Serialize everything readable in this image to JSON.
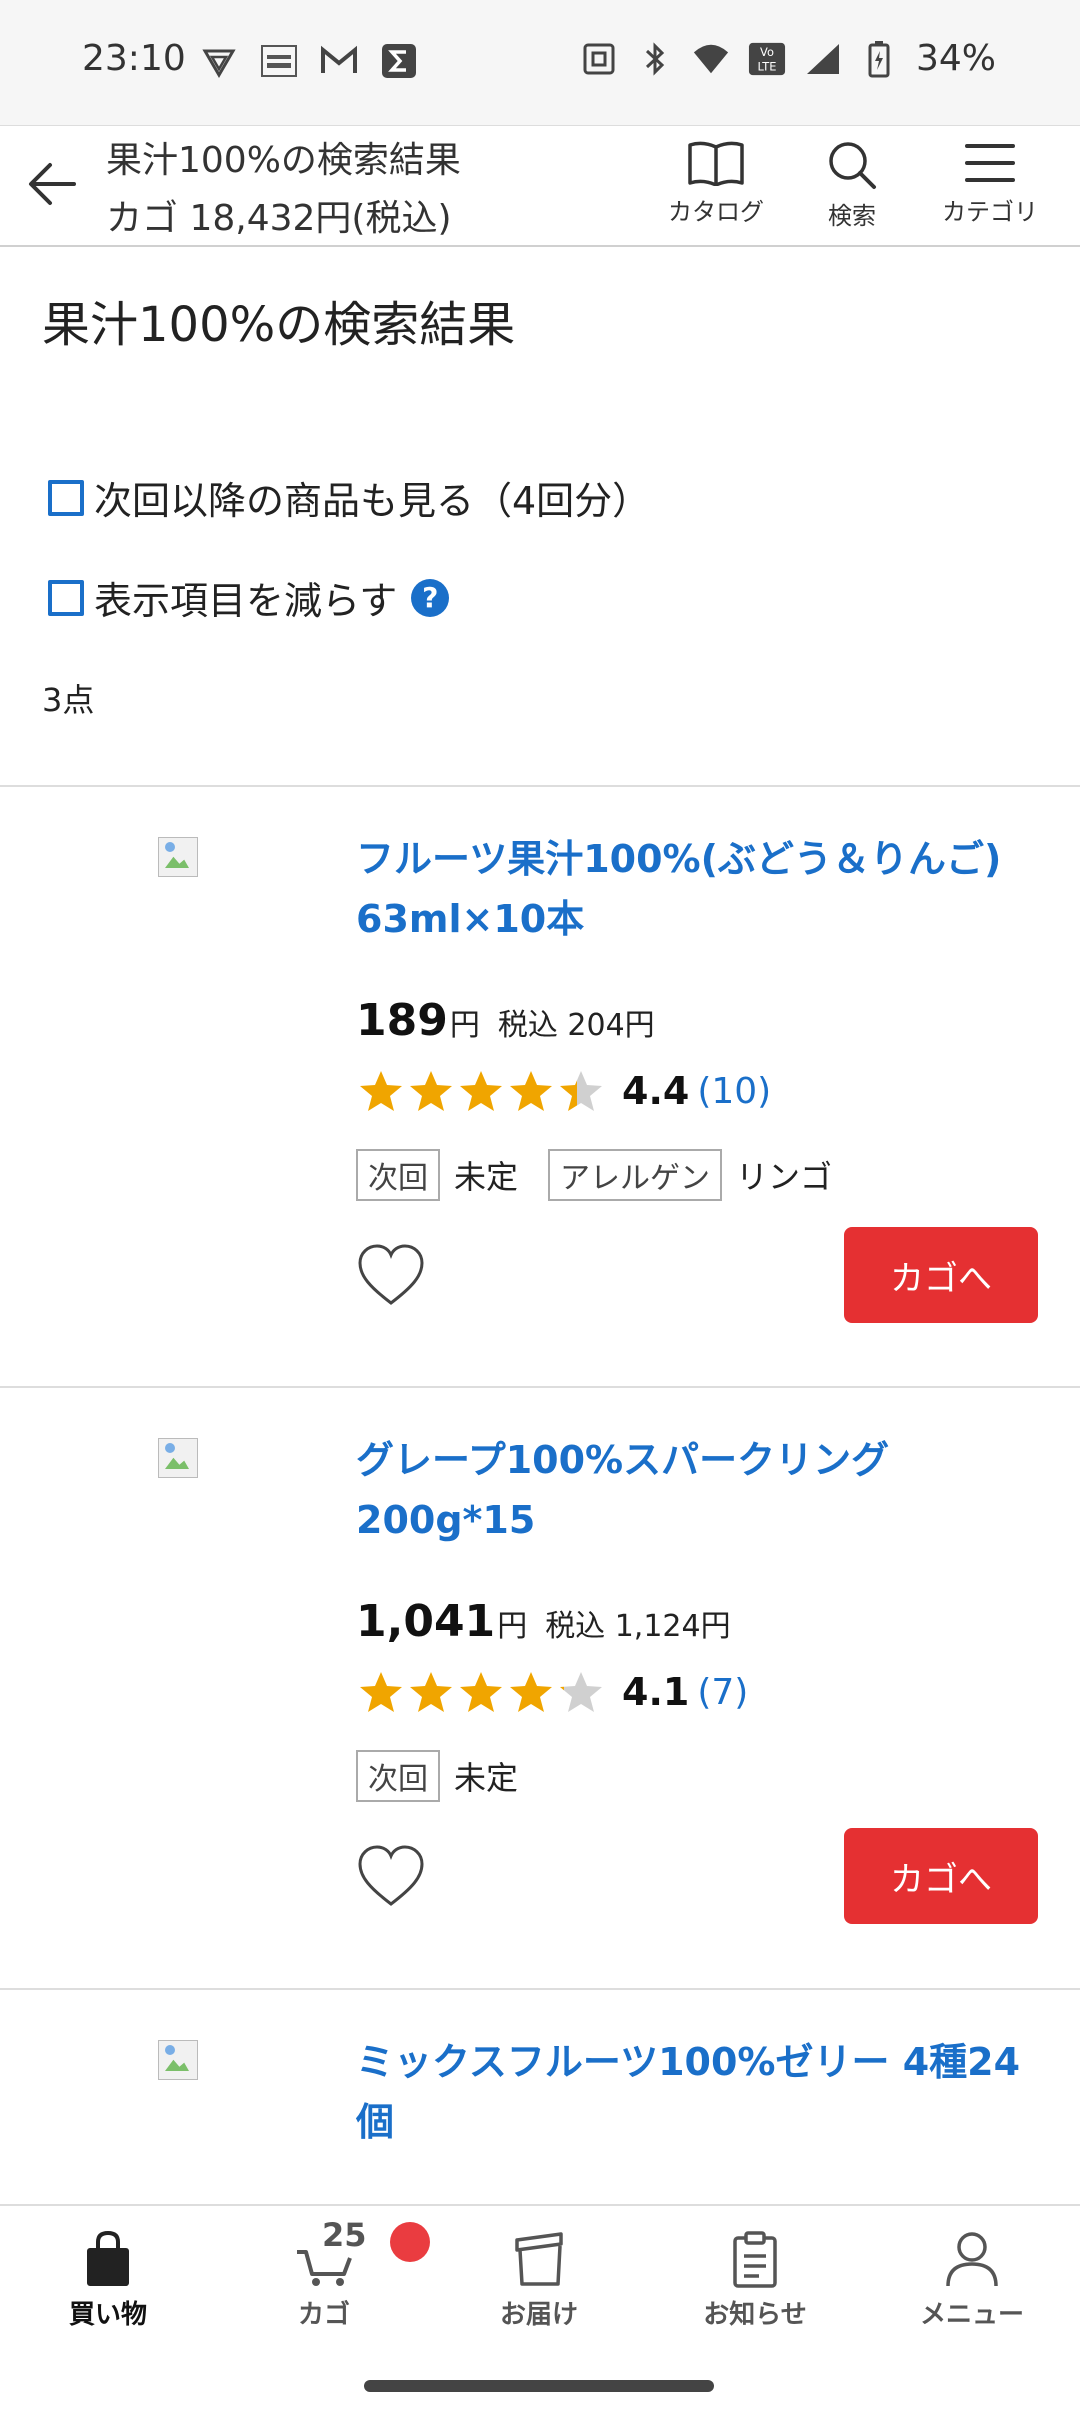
{
  "status_bar": {
    "time": "23:10",
    "battery": "34%",
    "left_icons": [
      "vpn-icon",
      "sports-bull-icon",
      "gmail-icon",
      "sigma-icon"
    ],
    "right_icons": [
      "nfc-icon",
      "bluetooth-icon",
      "wifi-icon",
      "volte-icon",
      "signal-icon",
      "battery-icon"
    ]
  },
  "header": {
    "title": "果汁100%の検索結果",
    "cart_total": "カゴ 18,432円(税込)",
    "catalog_label": "カタログ",
    "search_label": "検索",
    "category_label": "カテゴリ"
  },
  "page": {
    "title": "果汁100%の検索結果",
    "filter_next": "次回以降の商品も見る（4回分）",
    "filter_reduce": "表示項目を減らす",
    "help": "?",
    "count": "3点"
  },
  "products": [
    {
      "name": "フルーツ果汁100%(ぶどう＆りんご) 63ml×10本",
      "price": "189",
      "yen": "円",
      "tax_price": "税込 204円",
      "rating": "4.4",
      "rating_value": 4.4,
      "reviews": "(10)",
      "tag1_label": "次回",
      "tag1_value": "未定",
      "tag2_label": "アレルゲン",
      "tag2_value": "リンゴ",
      "cart_label": "カゴへ"
    },
    {
      "name": "グレープ100%スパークリング 200g*15",
      "price": "1,041",
      "yen": "円",
      "tax_price": "税込 1,124円",
      "rating": "4.1",
      "rating_value": 4.1,
      "reviews": "(7)",
      "tag1_label": "次回",
      "tag1_value": "未定",
      "cart_label": "カゴへ"
    },
    {
      "name": "ミックスフルーツ100%ゼリー 4種24個"
    }
  ],
  "bottom_nav": {
    "shopping": "買い物",
    "cart": "カゴ",
    "cart_count": "25",
    "delivery": "お届け",
    "news": "お知らせ",
    "menu": "メニュー"
  },
  "colors": {
    "accent_blue": "#1a6fc9",
    "cart_red": "#e53032",
    "star": "#f0a500",
    "star_empty": "#d0d0d0",
    "badge_red": "#ea3c40"
  }
}
